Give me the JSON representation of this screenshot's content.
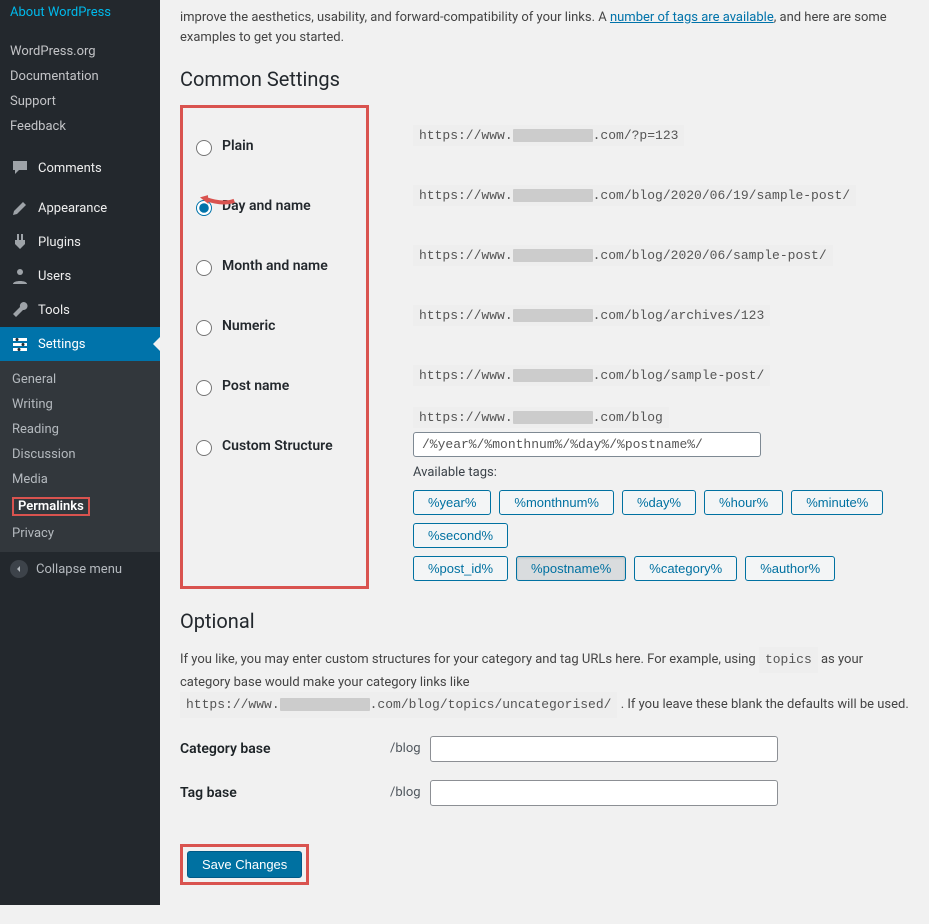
{
  "sidebar": {
    "topLinks": [
      "About WordPress",
      "WordPress.org",
      "Documentation",
      "Support",
      "Feedback"
    ],
    "menu": [
      {
        "key": "comments",
        "label": "Comments"
      },
      {
        "key": "appearance",
        "label": "Appearance"
      },
      {
        "key": "plugins",
        "label": "Plugins"
      },
      {
        "key": "users",
        "label": "Users"
      },
      {
        "key": "tools",
        "label": "Tools"
      },
      {
        "key": "settings",
        "label": "Settings"
      }
    ],
    "submenu": [
      "General",
      "Writing",
      "Reading",
      "Discussion",
      "Media",
      "Permalinks",
      "Privacy"
    ],
    "activeSub": "Permalinks",
    "collapse": "Collapse menu"
  },
  "intro": {
    "line1a": "improve the aesthetics, usability, and forward-compatibility of your links. A ",
    "link": "number of tags are available",
    "line1b": ", and here are some examples to get you started."
  },
  "commonHeading": "Common Settings",
  "options": [
    {
      "key": "plain",
      "label": "Plain",
      "url_pre": "https://www.",
      "url_post": ".com/?p=123",
      "selected": false
    },
    {
      "key": "dayname",
      "label": "Day and name",
      "url_pre": "https://www.",
      "url_post": ".com/blog/2020/06/19/sample-post/",
      "selected": true
    },
    {
      "key": "monthname",
      "label": "Month and name",
      "url_pre": "https://www.",
      "url_post": ".com/blog/2020/06/sample-post/",
      "selected": false
    },
    {
      "key": "numeric",
      "label": "Numeric",
      "url_pre": "https://www.",
      "url_post": ".com/blog/archives/123",
      "selected": false
    },
    {
      "key": "postname",
      "label": "Post name",
      "url_pre": "https://www.",
      "url_post": ".com/blog/sample-post/",
      "selected": false
    },
    {
      "key": "custom",
      "label": "Custom Structure",
      "url_pre": "https://www.",
      "url_post": ".com/blog",
      "selected": false
    }
  ],
  "customValue": "/%year%/%monthnum%/%day%/%postname%/",
  "availableLabel": "Available tags:",
  "tags_row1": [
    "%year%",
    "%monthnum%",
    "%day%",
    "%hour%",
    "%minute%",
    "%second%"
  ],
  "tags_row2": [
    "%post_id%",
    "%postname%",
    "%category%",
    "%author%"
  ],
  "selectedTags": [
    "%postname%"
  ],
  "optionalHeading": "Optional",
  "optional": {
    "text1": "If you like, you may enter custom structures for your category and tag URLs here. For example, using ",
    "code1": "topics",
    "text2": " as your category base would make your category links like ",
    "code2_pre": "https://www.",
    "code2_post": ".com/blog/topics/uncategorised/",
    "text3": " . If you leave these blank the defaults will be used."
  },
  "categoryBase": {
    "label": "Category base",
    "prefix": "/blog",
    "value": ""
  },
  "tagBase": {
    "label": "Tag base",
    "prefix": "/blog",
    "value": ""
  },
  "saveLabel": "Save Changes"
}
